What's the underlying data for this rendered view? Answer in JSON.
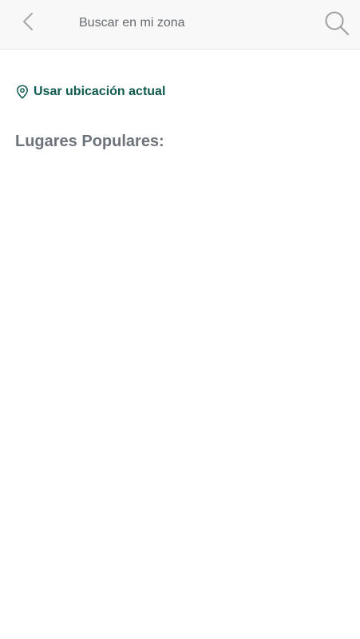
{
  "header": {
    "search_placeholder": "Buscar en mi zona",
    "back_icon": "chevron-left-icon",
    "search_icon": "magnifier-icon"
  },
  "location": {
    "label": "Usar ubicación actual",
    "icon": "map-pin-icon",
    "color": "#0e5a4e"
  },
  "popular": {
    "title": "Lugares Populares:",
    "items": []
  },
  "colors": {
    "header_bg": "#f8f8f8",
    "accent": "#0e5a4e",
    "section_title": "#6d737a"
  }
}
